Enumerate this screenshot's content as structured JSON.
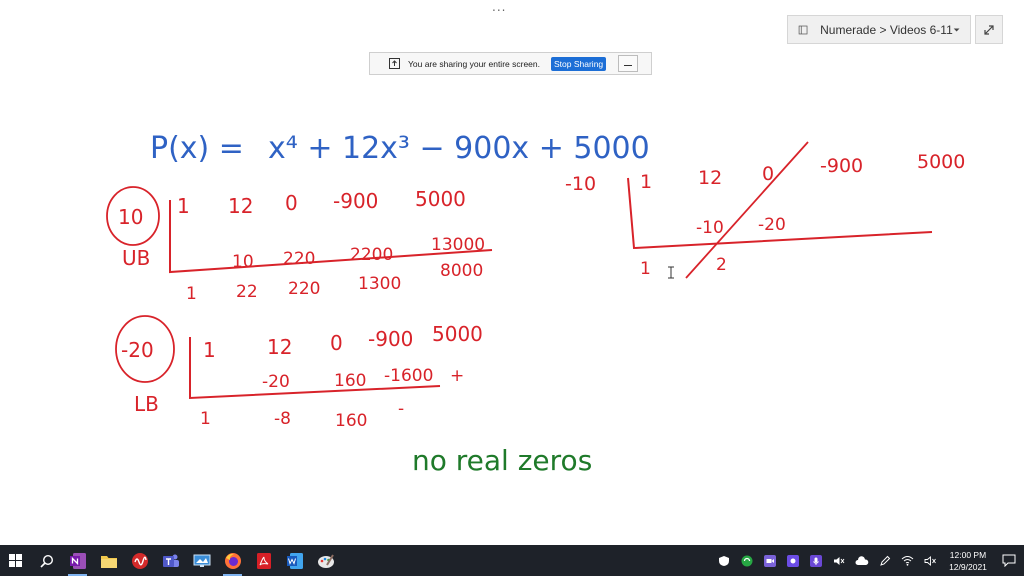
{
  "window": {
    "menu_dots": "..."
  },
  "notebook_selector": {
    "label": "Numerade > Videos 6-11"
  },
  "share_bar": {
    "message": "You are sharing your entire screen.",
    "stop_label": "Stop Sharing"
  },
  "canvas": {
    "equation": {
      "lhs": "P(x) =",
      "rhs": "x⁴ + 12x³ − 900x + 5000"
    },
    "upper_bound": {
      "test_value": "10",
      "tag": "UB",
      "coefficients": [
        "1",
        "12",
        "0",
        "-900",
        "5000"
      ],
      "products": [
        "10",
        "220",
        "2200",
        "13000"
      ],
      "results": [
        "1",
        "22",
        "220",
        "1300",
        "8000"
      ]
    },
    "lower_bound": {
      "test_value": "-20",
      "tag": "LB",
      "coefficients": [
        "1",
        "12",
        "0",
        "-900",
        "5000"
      ],
      "products": [
        "-20",
        "160",
        "-1600",
        "+"
      ],
      "results": [
        "1",
        "-8",
        "160",
        "-"
      ]
    },
    "right_division": {
      "test_value": "-10",
      "coefficients": [
        "1",
        "12",
        "0",
        "-900",
        "5000"
      ],
      "products": [
        "-10",
        "-20"
      ],
      "results": [
        "1",
        "2"
      ]
    },
    "conclusion": "no real zeros"
  },
  "taskbar": {
    "apps": [
      "windows-start",
      "search",
      "onenote",
      "file-explorer",
      "ravel",
      "teams",
      "screen-capture",
      "firefox",
      "acrobat",
      "word",
      "paint"
    ],
    "active_app": "firefox"
  },
  "clock": {
    "time": "12:00 PM",
    "date": "12/9/2021"
  },
  "colors": {
    "ink_blue": "#2f62c4",
    "ink_red": "#d8232a",
    "ink_green": "#1f7a2a",
    "taskbar_bg": "#1e2229",
    "stop_button": "#1c6ed6"
  }
}
